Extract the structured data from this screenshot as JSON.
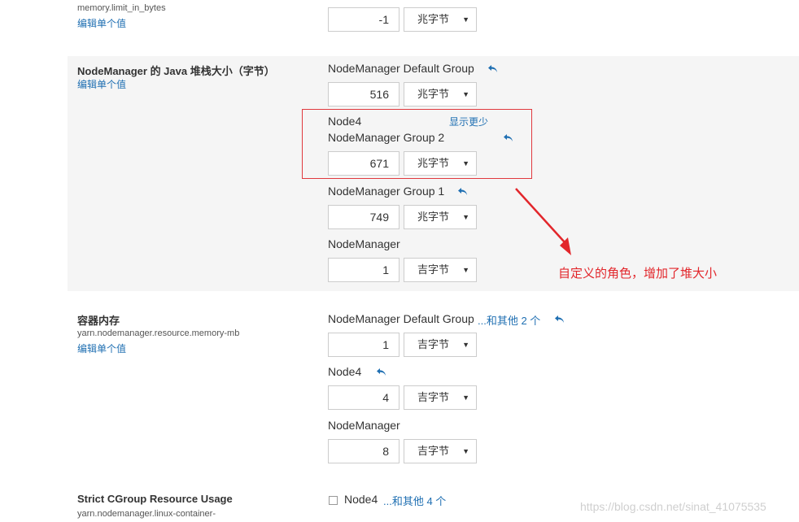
{
  "top": {
    "key": "memory.limit_in_bytes",
    "edit_link": "编辑单个值",
    "value": "-1",
    "unit": "兆字节"
  },
  "heap": {
    "title": "NodeManager 的 Java 堆栈大小（字节）",
    "edit_link": "编辑单个值",
    "groups": [
      {
        "name": "NodeManager Default Group",
        "value": "516",
        "unit": "兆字节"
      },
      {
        "name": "NodeManager Group 2",
        "node": "Node4",
        "show_less": "显示更少",
        "value": "671",
        "unit": "兆字节"
      },
      {
        "name": "NodeManager Group 1",
        "value": "749",
        "unit": "兆字节"
      },
      {
        "name": "NodeManager",
        "value": "1",
        "unit": "吉字节"
      }
    ]
  },
  "annotation": {
    "text": "自定义的角色，增加了堆大小",
    "color": "#e2262b"
  },
  "container_mem": {
    "title": "容器内存",
    "key": "yarn.nodemanager.resource.memory-mb",
    "edit_link": "编辑单个值",
    "groups": [
      {
        "name": "NodeManager Default Group",
        "more": "...和其他 2 个",
        "value": "1",
        "unit": "吉字节"
      },
      {
        "name": "Node4",
        "value": "4",
        "unit": "吉字节"
      },
      {
        "name": "NodeManager",
        "value": "8",
        "unit": "吉字节"
      }
    ]
  },
  "cgroup": {
    "title": "Strict CGroup Resource Usage",
    "key": "yarn.nodemanager.linux-container-",
    "checkbox_label": "Node4",
    "more": "...和其他 4 个"
  },
  "watermark": "https://blog.csdn.net/sinat_41075535",
  "colors": {
    "link": "#1f6fb2",
    "annotation_red": "#e2262b",
    "band": "#f5f5f5"
  },
  "icons": {
    "undo": "undo-arrow-icon",
    "caret": "caret-down-icon"
  }
}
